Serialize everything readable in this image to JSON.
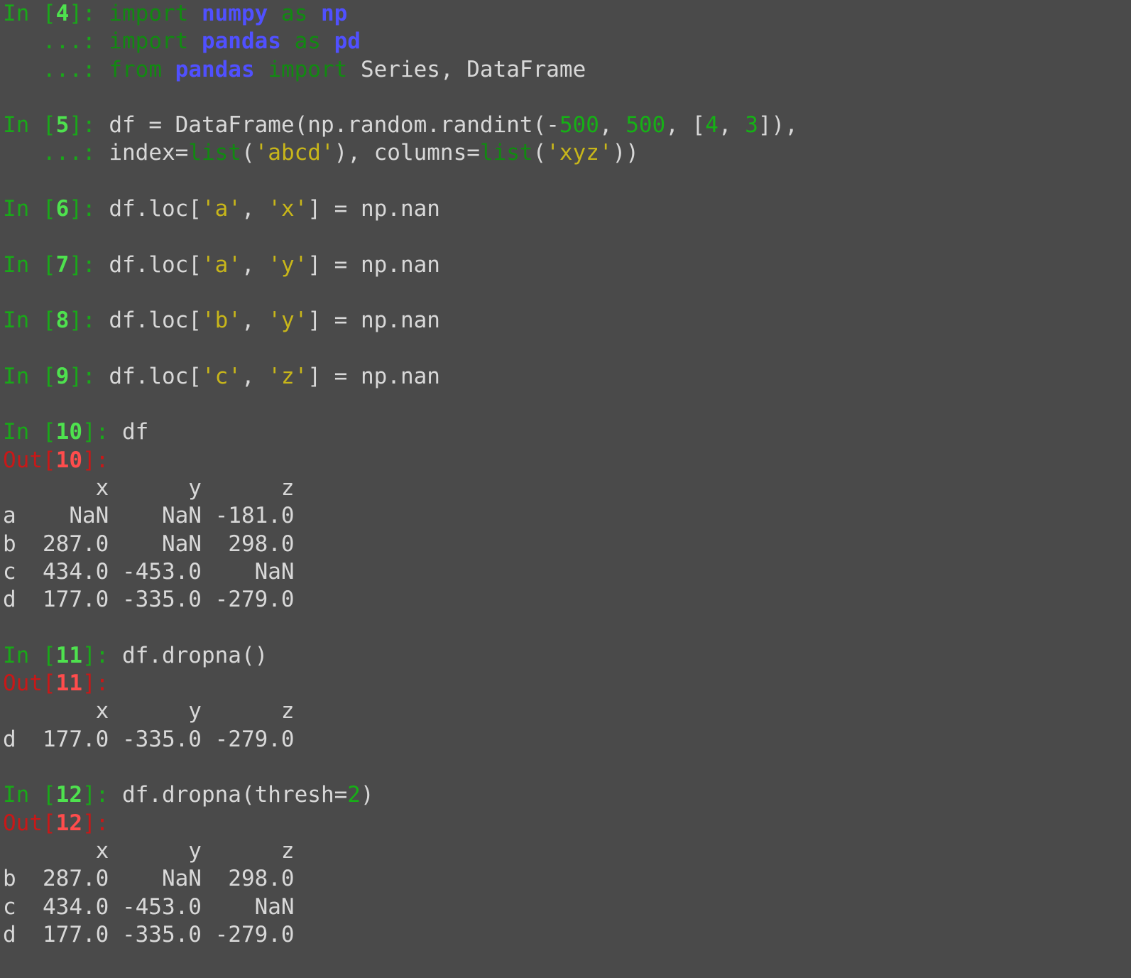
{
  "prompt": {
    "in": "In",
    "out": "Out",
    "cont": "...:"
  },
  "cells": [
    {
      "number": "4",
      "lines": [
        [
          [
            "kw",
            "import"
          ],
          [
            "txt",
            " "
          ],
          [
            "mod",
            "numpy"
          ],
          [
            "txt",
            " "
          ],
          [
            "kw",
            "as"
          ],
          [
            "txt",
            " "
          ],
          [
            "mod",
            "np"
          ]
        ],
        [
          [
            "kw",
            "import"
          ],
          [
            "txt",
            " "
          ],
          [
            "mod",
            "pandas"
          ],
          [
            "txt",
            " "
          ],
          [
            "kw",
            "as"
          ],
          [
            "txt",
            " "
          ],
          [
            "mod",
            "pd"
          ]
        ],
        [
          [
            "kw",
            "from"
          ],
          [
            "txt",
            " "
          ],
          [
            "mod",
            "pandas"
          ],
          [
            "txt",
            " "
          ],
          [
            "kw",
            "import"
          ],
          [
            "txt",
            " Series, DataFrame"
          ]
        ]
      ]
    },
    {
      "number": "5",
      "lines": [
        [
          [
            "txt",
            "df = DataFrame(np.random.randint(-"
          ],
          [
            "num",
            "500"
          ],
          [
            "txt",
            ", "
          ],
          [
            "num",
            "500"
          ],
          [
            "txt",
            ", ["
          ],
          [
            "num",
            "4"
          ],
          [
            "txt",
            ", "
          ],
          [
            "num",
            "3"
          ],
          [
            "txt",
            "]),"
          ]
        ],
        [
          [
            "txt",
            "index="
          ],
          [
            "bi",
            "list"
          ],
          [
            "txt",
            "("
          ],
          [
            "str",
            "'abcd'"
          ],
          [
            "txt",
            "), columns="
          ],
          [
            "bi",
            "list"
          ],
          [
            "txt",
            "("
          ],
          [
            "str",
            "'xyz'"
          ],
          [
            "txt",
            "))"
          ]
        ]
      ]
    },
    {
      "number": "6",
      "lines": [
        [
          [
            "txt",
            "df.loc["
          ],
          [
            "str",
            "'a'"
          ],
          [
            "txt",
            ", "
          ],
          [
            "str",
            "'x'"
          ],
          [
            "txt",
            "] = np.nan"
          ]
        ]
      ]
    },
    {
      "number": "7",
      "lines": [
        [
          [
            "txt",
            "df.loc["
          ],
          [
            "str",
            "'a'"
          ],
          [
            "txt",
            ", "
          ],
          [
            "str",
            "'y'"
          ],
          [
            "txt",
            "] = np.nan"
          ]
        ]
      ]
    },
    {
      "number": "8",
      "lines": [
        [
          [
            "txt",
            "df.loc["
          ],
          [
            "str",
            "'b'"
          ],
          [
            "txt",
            ", "
          ],
          [
            "str",
            "'y'"
          ],
          [
            "txt",
            "] = np.nan"
          ]
        ]
      ]
    },
    {
      "number": "9",
      "lines": [
        [
          [
            "txt",
            "df.loc["
          ],
          [
            "str",
            "'c'"
          ],
          [
            "txt",
            ", "
          ],
          [
            "str",
            "'z'"
          ],
          [
            "txt",
            "] = np.nan"
          ]
        ]
      ]
    },
    {
      "number": "10",
      "lines": [
        [
          [
            "txt",
            "df"
          ]
        ]
      ],
      "output": [
        "       x      y      z",
        "a    NaN    NaN -181.0",
        "b  287.0    NaN  298.0",
        "c  434.0 -453.0    NaN",
        "d  177.0 -335.0 -279.0"
      ]
    },
    {
      "number": "11",
      "lines": [
        [
          [
            "txt",
            "df.dropna()"
          ]
        ]
      ],
      "output": [
        "       x      y      z",
        "d  177.0 -335.0 -279.0"
      ]
    },
    {
      "number": "12",
      "lines": [
        [
          [
            "txt",
            "df.dropna(thresh="
          ],
          [
            "num",
            "2"
          ],
          [
            "txt",
            ")"
          ]
        ]
      ],
      "output": [
        "       x      y      z",
        "b  287.0    NaN  298.0",
        "c  434.0 -453.0    NaN",
        "d  177.0 -335.0 -279.0"
      ]
    }
  ],
  "colors": {
    "background": "#4a4a4a",
    "text": "#d8d8d8",
    "prompt_in": "#19a819",
    "prompt_out": "#c81818",
    "keyword": "#118a11",
    "module": "#5050ff",
    "string": "#c8b61a",
    "number": "#16b016"
  }
}
